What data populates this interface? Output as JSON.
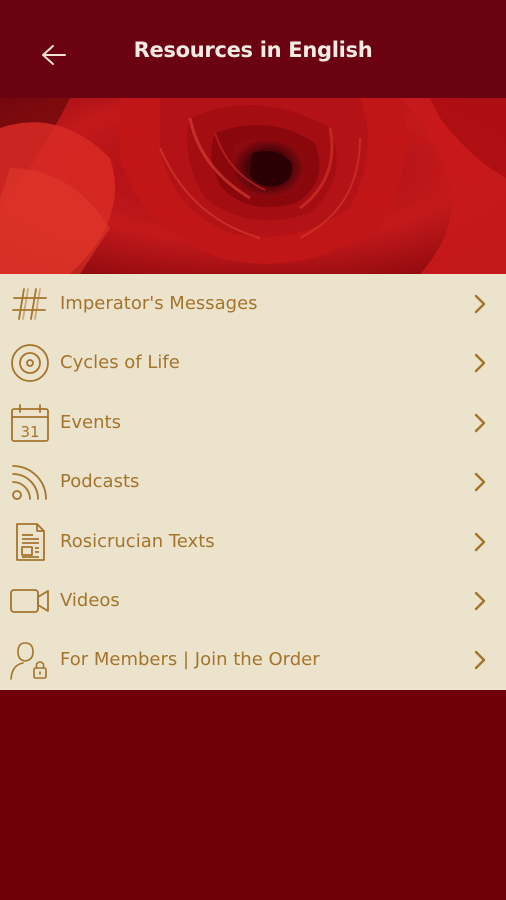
{
  "header": {
    "title": "Resources in English",
    "back_icon": "arrow-left-icon"
  },
  "colors": {
    "header_bg": "#6b0212",
    "page_bg": "#6f0009",
    "menu_bg": "#ebe3cc",
    "accent": "#a5742c",
    "title_text": "#f4ebe3"
  },
  "hero": {
    "image": "red-rose-photo"
  },
  "menu": {
    "items": [
      {
        "label": "Imperator's Messages",
        "icon": "hashtag-icon"
      },
      {
        "label": "Cycles of Life",
        "icon": "vinyl-record-icon"
      },
      {
        "label": "Events",
        "icon": "calendar-icon"
      },
      {
        "label": "Podcasts",
        "icon": "rss-feed-icon"
      },
      {
        "label": "Rosicrucian Texts",
        "icon": "document-icon"
      },
      {
        "label": "Videos",
        "icon": "video-camera-icon"
      },
      {
        "label": "For Members | Join the Order",
        "icon": "member-lock-icon"
      }
    ],
    "chevron_icon": "chevron-right-icon",
    "calendar_day": "31"
  }
}
